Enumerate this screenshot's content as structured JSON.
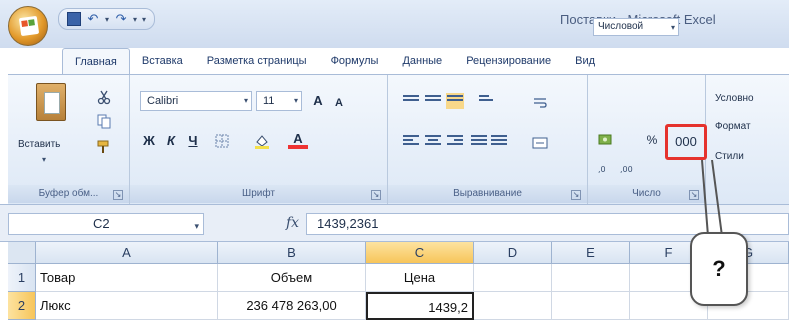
{
  "app": {
    "title": "Поставки - Microsoft Excel"
  },
  "tabs": [
    "Главная",
    "Вставка",
    "Разметка страницы",
    "Формулы",
    "Данные",
    "Рецензирование",
    "Вид"
  ],
  "ribbon": {
    "clipboard": {
      "paste_label": "Вставить",
      "group_label": "Буфер обм..."
    },
    "font": {
      "name": "Calibri",
      "size": "11",
      "grow": "A",
      "shrink": "A",
      "bold": "Ж",
      "italic": "К",
      "underline": "Ч",
      "color_letter": "А",
      "group_label": "Шрифт"
    },
    "alignment": {
      "group_label": "Выравнивание"
    },
    "number": {
      "format": "Числовой",
      "percent": "%",
      "thousands": "000",
      "group_label": "Число"
    },
    "styles": {
      "conditional": "Условно",
      "format_table": "Формат",
      "cell_styles": "Стили"
    }
  },
  "formula_bar": {
    "name_box": "C2",
    "fx": "fx",
    "formula": "1439,2361"
  },
  "grid": {
    "columns": [
      "A",
      "B",
      "C",
      "D",
      "E",
      "F",
      "G"
    ],
    "rows": [
      {
        "num": "1",
        "cells": [
          "Товар",
          "Объем",
          "Цена"
        ]
      },
      {
        "num": "2",
        "cells": [
          "Люкс",
          "236 478 263,00",
          "1439,2"
        ]
      }
    ]
  },
  "callout": {
    "text": "?"
  },
  "colors": {
    "highlight": "#e5322d",
    "selected_header": "#f7c55a",
    "ribbon": "#dde8f6"
  }
}
